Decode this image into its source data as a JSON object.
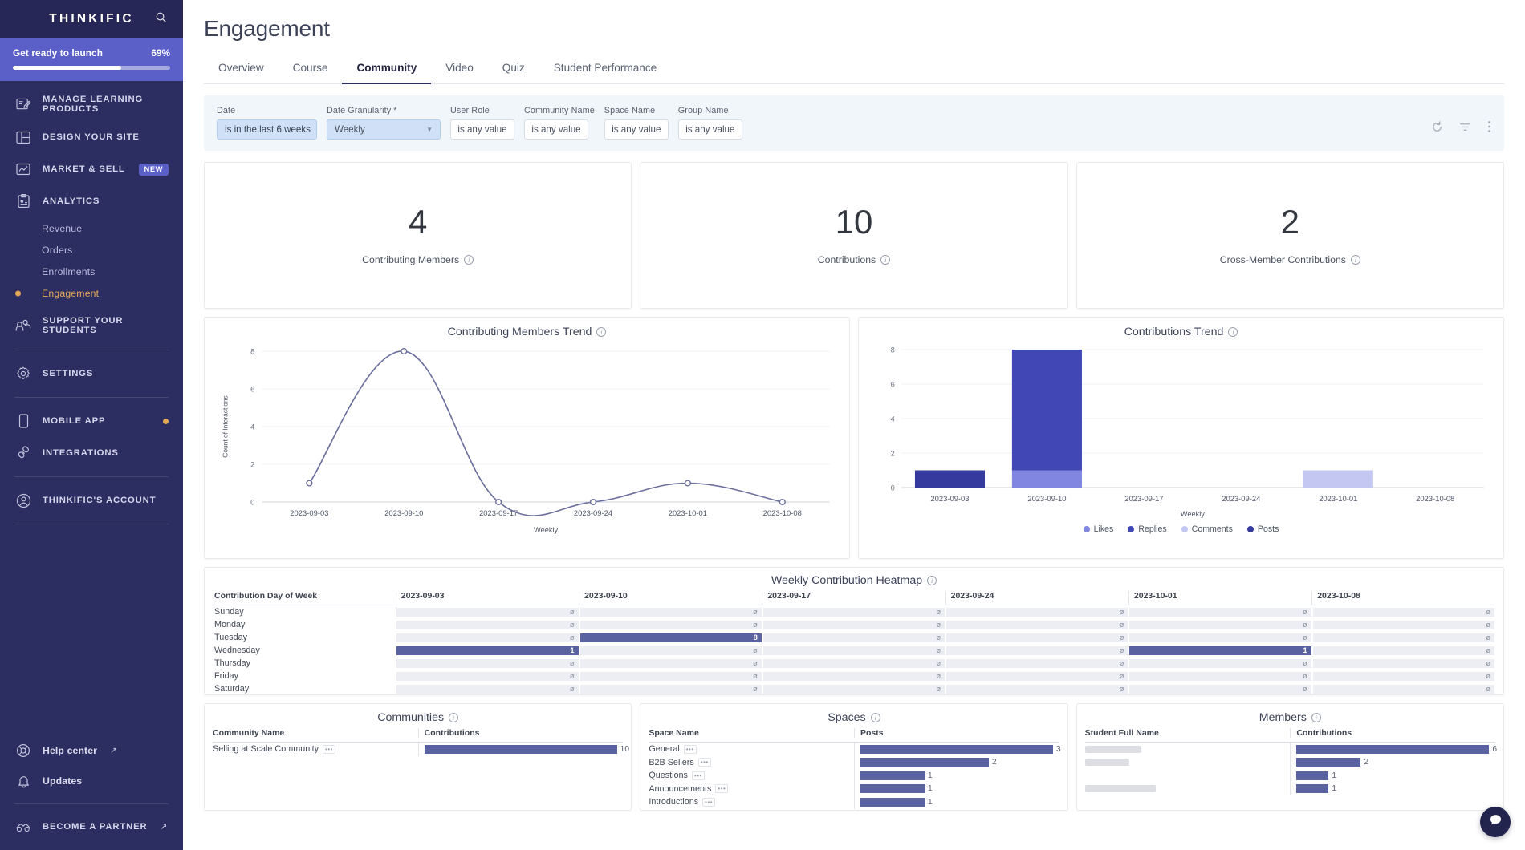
{
  "sidebar": {
    "brand": "THINKIFIC",
    "search_icon": "search-icon",
    "launch": {
      "title": "Get ready to launch",
      "percent_label": "69%",
      "percent": 69
    },
    "nav": [
      {
        "label": "MANAGE LEARNING PRODUCTS",
        "icon": "pencil-board-icon"
      },
      {
        "label": "DESIGN YOUR SITE",
        "icon": "layout-icon"
      },
      {
        "label": "MARKET & SELL",
        "icon": "chart-screen-icon",
        "badge": "NEW"
      },
      {
        "label": "ANALYTICS",
        "icon": "clipboard-chart-icon"
      }
    ],
    "analytics_sub": [
      {
        "label": "Revenue",
        "active": false
      },
      {
        "label": "Orders",
        "active": false
      },
      {
        "label": "Enrollments",
        "active": false
      },
      {
        "label": "Engagement",
        "active": true
      }
    ],
    "nav2": [
      {
        "label": "SUPPORT YOUR STUDENTS",
        "icon": "people-icon"
      }
    ],
    "nav3": [
      {
        "label": "SETTINGS",
        "icon": "gear-icon"
      }
    ],
    "nav4": [
      {
        "label": "MOBILE APP",
        "icon": "phone-icon",
        "dot": true
      },
      {
        "label": "INTEGRATIONS",
        "icon": "plug-icon"
      }
    ],
    "nav5": [
      {
        "label": "THINKIFIC'S ACCOUNT",
        "icon": "user-circle-icon"
      }
    ],
    "footer": [
      {
        "label": "Help center",
        "icon": "lifebuoy-icon",
        "external": "↗"
      },
      {
        "label": "Updates",
        "icon": "bell-icon",
        "external": ""
      }
    ],
    "partner": {
      "label": "BECOME A PARTNER",
      "icon": "handshake-icon",
      "external": "↗"
    }
  },
  "header": {
    "title": "Engagement",
    "tabs": [
      {
        "label": "Overview",
        "active": false
      },
      {
        "label": "Course",
        "active": false
      },
      {
        "label": "Community",
        "active": true
      },
      {
        "label": "Video",
        "active": false
      },
      {
        "label": "Quiz",
        "active": false
      },
      {
        "label": "Student Performance",
        "active": false
      }
    ]
  },
  "filters": {
    "fields": [
      {
        "label": "Date",
        "value": "is in the last 6 weeks",
        "type": "filled",
        "width": "date"
      },
      {
        "label": "Date Granularity *",
        "value": "Weekly",
        "type": "select",
        "width": "sel"
      },
      {
        "label": "User Role",
        "value": "is any value",
        "type": "plain",
        "width": "any"
      },
      {
        "label": "Community Name",
        "value": "is any value",
        "type": "plain",
        "width": "any"
      },
      {
        "label": "Space Name",
        "value": "is any value",
        "type": "plain",
        "width": "any"
      },
      {
        "label": "Group Name",
        "value": "is any value",
        "type": "plain",
        "width": "any"
      }
    ],
    "actions": [
      {
        "name": "refresh-icon"
      },
      {
        "name": "filter-icon"
      },
      {
        "name": "more-options-icon"
      }
    ]
  },
  "kpis": [
    {
      "value": "4",
      "caption": "Contributing Members"
    },
    {
      "value": "10",
      "caption": "Contributions"
    },
    {
      "value": "2",
      "caption": "Cross-Member Contributions"
    }
  ],
  "panels": {
    "members_trend_title": "Contributing Members Trend",
    "contributions_trend_title": "Contributions Trend",
    "heatmap_title": "Weekly Contribution Heatmap",
    "communities_title": "Communities",
    "spaces_title": "Spaces",
    "members_title": "Members"
  },
  "chart_data": [
    {
      "type": "line",
      "title": "Contributing Members Trend",
      "xlabel": "Weekly",
      "ylabel": "Count of Interactions",
      "categories": [
        "2023-09-03",
        "2023-09-10",
        "2023-09-17",
        "2023-09-24",
        "2023-10-01",
        "2023-10-08"
      ],
      "values": [
        1,
        8,
        0,
        0,
        1,
        0
      ],
      "ylim": [
        0,
        8
      ],
      "yticks": [
        0,
        2,
        4,
        6,
        8
      ],
      "grid": true,
      "line_color": "#6b6f9c",
      "marker": "open-circle"
    },
    {
      "type": "bar",
      "subtype": "stacked",
      "title": "Contributions Trend",
      "xlabel": "Weekly",
      "ylabel": "",
      "categories": [
        "2023-09-03",
        "2023-09-10",
        "2023-09-17",
        "2023-09-24",
        "2023-10-01",
        "2023-10-08"
      ],
      "series": [
        {
          "name": "Likes",
          "color": "#8187e0",
          "values": [
            0,
            1,
            0,
            0,
            0,
            0
          ]
        },
        {
          "name": "Replies",
          "color": "#4148b5",
          "values": [
            0,
            7,
            0,
            0,
            0,
            0
          ]
        },
        {
          "name": "Comments",
          "color": "#c3c7f2",
          "values": [
            0,
            0,
            0,
            0,
            1,
            0
          ]
        },
        {
          "name": "Posts",
          "color": "#343a9e",
          "values": [
            1,
            0,
            0,
            0,
            0,
            0
          ]
        }
      ],
      "ylim": [
        0,
        8
      ],
      "yticks": [
        0,
        2,
        4,
        6,
        8
      ],
      "grid": true,
      "legend_position": "bottom"
    },
    {
      "type": "heatmap",
      "title": "Weekly Contribution Heatmap",
      "row_header": "Contribution Day of Week",
      "columns": [
        "2023-09-03",
        "2023-09-10",
        "2023-09-17",
        "2023-09-24",
        "2023-10-01",
        "2023-10-08"
      ],
      "rows": [
        "Sunday",
        "Monday",
        "Tuesday",
        "Wednesday",
        "Thursday",
        "Friday",
        "Saturday"
      ],
      "null_symbol": "ø",
      "values": [
        [
          null,
          null,
          null,
          null,
          null,
          null
        ],
        [
          null,
          null,
          null,
          null,
          null,
          null
        ],
        [
          null,
          8,
          null,
          null,
          null,
          null
        ],
        [
          1,
          null,
          null,
          null,
          1,
          null
        ],
        [
          null,
          null,
          null,
          null,
          null,
          null
        ],
        [
          null,
          null,
          null,
          null,
          null,
          null
        ],
        [
          null,
          null,
          null,
          null,
          null,
          null
        ]
      ],
      "hot_color": "#5b62a0",
      "empty_color": "#eceef3"
    },
    {
      "type": "bar",
      "subtype": "horizontal-table",
      "title": "Communities",
      "columns": [
        "Community Name",
        "Contributions"
      ],
      "categories": [
        "Selling at Scale Community"
      ],
      "values": [
        10
      ],
      "max": 10,
      "bar_color": "#5b62a0"
    },
    {
      "type": "bar",
      "subtype": "horizontal-table",
      "title": "Spaces",
      "columns": [
        "Space Name",
        "Posts"
      ],
      "categories": [
        "General",
        "B2B Sellers",
        "Questions",
        "Announcements",
        "Introductions"
      ],
      "values": [
        3,
        2,
        1,
        1,
        1
      ],
      "max": 3,
      "bar_color": "#5b62a0"
    },
    {
      "type": "bar",
      "subtype": "horizontal-table",
      "title": "Members",
      "columns": [
        "Student Full Name",
        "Contributions"
      ],
      "categories": [
        "",
        "",
        "",
        ""
      ],
      "names_redacted": true,
      "values": [
        6,
        2,
        1,
        1
      ],
      "max": 6,
      "bar_color": "#5b62a0"
    }
  ],
  "chat": {
    "icon": "chat-bubble-icon"
  }
}
